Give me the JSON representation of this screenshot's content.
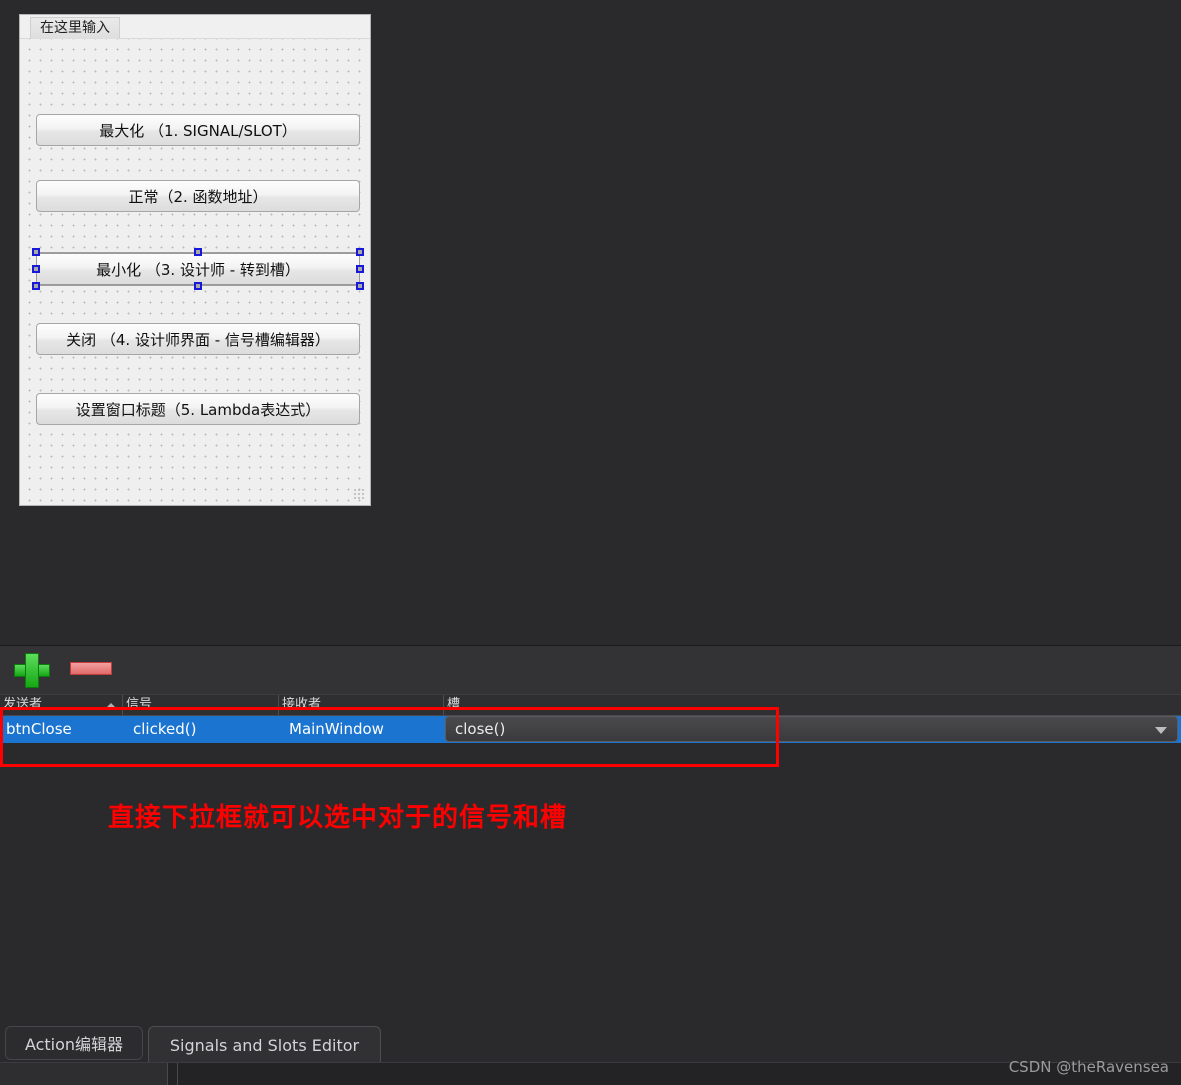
{
  "form": {
    "menu_type_here": "在这里输入",
    "buttons": [
      {
        "name": "maximize",
        "label": "最大化 （1. SIGNAL/SLOT）"
      },
      {
        "name": "normal",
        "label": "正常（2. 函数地址）"
      },
      {
        "name": "minimize",
        "label": "最小化 （3. 设计师 - 转到槽）"
      },
      {
        "name": "close",
        "label": "关闭 （4. 设计师界面 - 信号槽编辑器）"
      },
      {
        "name": "set-title",
        "label": "设置窗口标题（5. Lambda表达式）"
      }
    ],
    "selected_button_index": 2
  },
  "editor": {
    "toolbar": {
      "add_label": "add-connection",
      "remove_label": "remove-connection"
    },
    "table": {
      "headers": [
        "发送者",
        "信号",
        "接收者",
        "槽"
      ],
      "sorted_column": "发送者",
      "rows": [
        {
          "sender": "btnClose",
          "signal": "clicked()",
          "receiver": "MainWindow",
          "slot": "close()"
        }
      ]
    }
  },
  "annotation": {
    "note": "直接下拉框就可以选中对于的信号和槽",
    "color": "#fe0000"
  },
  "bottom_tabs": [
    {
      "label": "Action编辑器",
      "active": false
    },
    {
      "label": "Signals and Slots Editor",
      "active": true
    }
  ],
  "watermark": "CSDN @theRavensea",
  "colors": {
    "background": "#2a2a2c",
    "selection_blue": "#1a74d0",
    "accent_red": "#fe0000",
    "form_bg": "#efefef"
  }
}
